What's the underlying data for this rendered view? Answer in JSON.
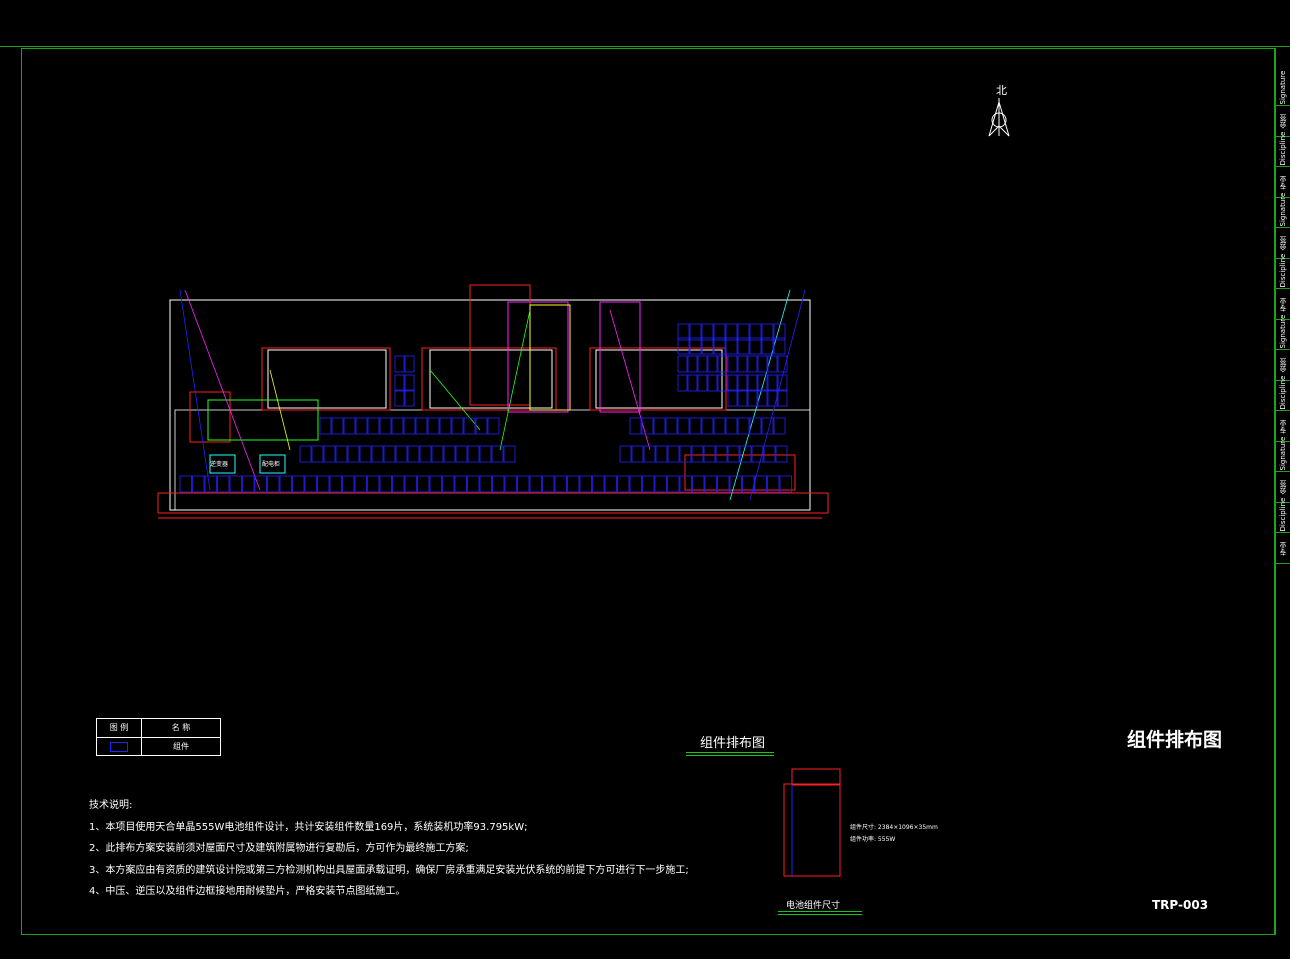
{
  "north": {
    "label": "北"
  },
  "legend": {
    "header": [
      "图 例",
      "名 称"
    ],
    "row": "组件"
  },
  "notes": {
    "heading": "技术说明:",
    "items": [
      "1、本项目使用天合单晶555W电池组件设计，共计安装组件数量169片，系统装机功率93.795kW;",
      "2、此排布方案安装前须对屋面尺寸及建筑附属物进行复勘后，方可作为最终施工方案;",
      "3、本方案应由有资质的建筑设计院或第三方检测机构出具屋面承载证明，确保厂房承重满足安装光伏系统的前提下方可进行下一步施工;",
      "4、中压、逆压以及组件边框接地用耐候垫片，严格安装节点图纸施工。"
    ]
  },
  "layout_title": "组件排布图",
  "drawing_title": "组件排布图",
  "module_panel": {
    "title": "电池组件尺寸",
    "spec_lines": [
      "组件尺寸: 2384×1096×35mm",
      "组件功率: 555W"
    ]
  },
  "drawing_no": "TRP-003",
  "sidebar_labels": [
    "Signature",
    "会签",
    "Discipline",
    "专业",
    "Signature",
    "会签",
    "Discipline",
    "专业",
    "Signature",
    "会签",
    "Discipline",
    "专业",
    "Signature",
    "会签",
    "Discipline",
    "专业"
  ],
  "plan_labels": [
    "逆变器",
    "配电柜"
  ],
  "colors": {
    "frame": "#19a419",
    "module": "#2222ff",
    "roof": "#ffffff",
    "boundary": "#ff2020",
    "accent_magenta": "#ff20ff",
    "accent_green": "#20ff20",
    "accent_yellow": "#ffff20",
    "accent_cyan": "#20ffff"
  }
}
